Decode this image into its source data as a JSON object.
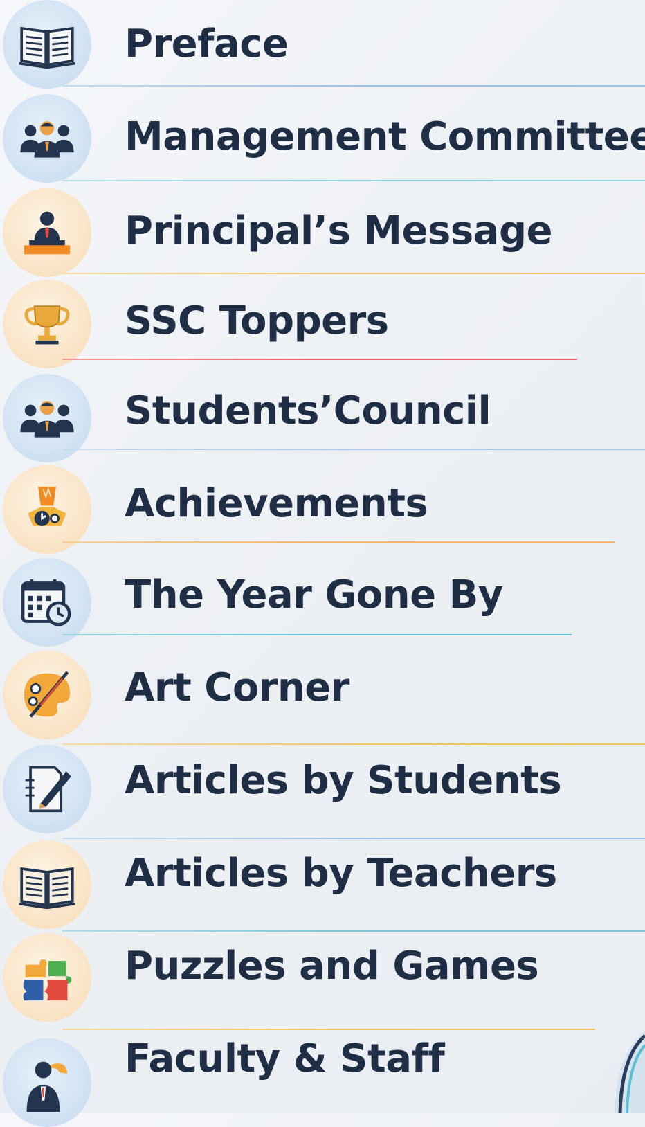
{
  "toc": {
    "items": [
      {
        "label": "Preface",
        "icon": "open-book-icon",
        "bg": "blue",
        "line_color": "#9fc3e6"
      },
      {
        "label": "Management Committee",
        "icon": "group-icon",
        "bg": "blue",
        "line_color": "#8fd0dc"
      },
      {
        "label": "Principal’s Message",
        "icon": "speaker-podium-icon",
        "bg": "orange",
        "line_color": "#f2c46a"
      },
      {
        "label": "SSC Toppers",
        "icon": "trophy-icon",
        "bg": "orange",
        "line_color": "#e5686a"
      },
      {
        "label": "Students’Council",
        "icon": "group-icon",
        "bg": "blue",
        "line_color": "#9fc3e6"
      },
      {
        "label": "Achievements",
        "icon": "award-medal-icon",
        "bg": "orange",
        "line_color": "#f2b36e"
      },
      {
        "label": "The Year Gone By",
        "icon": "calendar-clock-icon",
        "bg": "blue",
        "line_color": "#5cc0d2"
      },
      {
        "label": "Art Corner",
        "icon": "palette-brush-icon",
        "bg": "orange",
        "line_color": "#f2c46a"
      },
      {
        "label": "Articles by Students",
        "icon": "pen-paper-icon",
        "bg": "blue",
        "line_color": "#9fc3e6"
      },
      {
        "label": "Articles by Teachers",
        "icon": "open-book-icon",
        "bg": "orange",
        "line_color": "#7cc6d6"
      },
      {
        "label": "Puzzles and Games",
        "icon": "puzzle-pieces-icon",
        "bg": "orange",
        "line_color": "#f2c46a"
      },
      {
        "label": "Faculty & Staff",
        "icon": "teacher-icon",
        "bg": "blue",
        "line_color": "#9fc3e6"
      }
    ]
  }
}
